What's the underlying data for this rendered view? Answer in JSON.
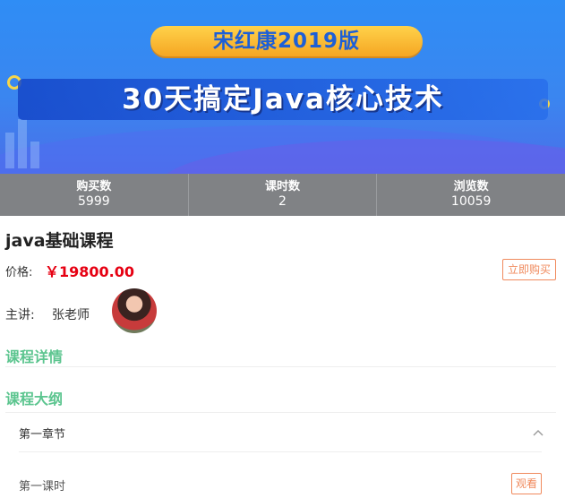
{
  "banner": {
    "edition": "宋红康2019版",
    "headline": "30天搞定Java核心技术"
  },
  "stats": [
    {
      "label": "购买数",
      "value": "5999"
    },
    {
      "label": "课时数",
      "value": "2"
    },
    {
      "label": "浏览数",
      "value": "10059"
    }
  ],
  "course": {
    "title": "java基础课程",
    "price_label": "价格:",
    "price": "￥19800.00",
    "buy_label": "立即购买",
    "teacher_label": "主讲:",
    "teacher_name": "张老师"
  },
  "sections": {
    "details": "课程详情",
    "outline": "课程大纲"
  },
  "outline": {
    "chapter": "第一章节",
    "lesson": "第一课时",
    "watch_label": "观看"
  },
  "colors": {
    "accent_green": "#5cc58f",
    "price_red": "#e60012",
    "button_orange": "#f08a5d",
    "stats_gray": "#808285"
  }
}
